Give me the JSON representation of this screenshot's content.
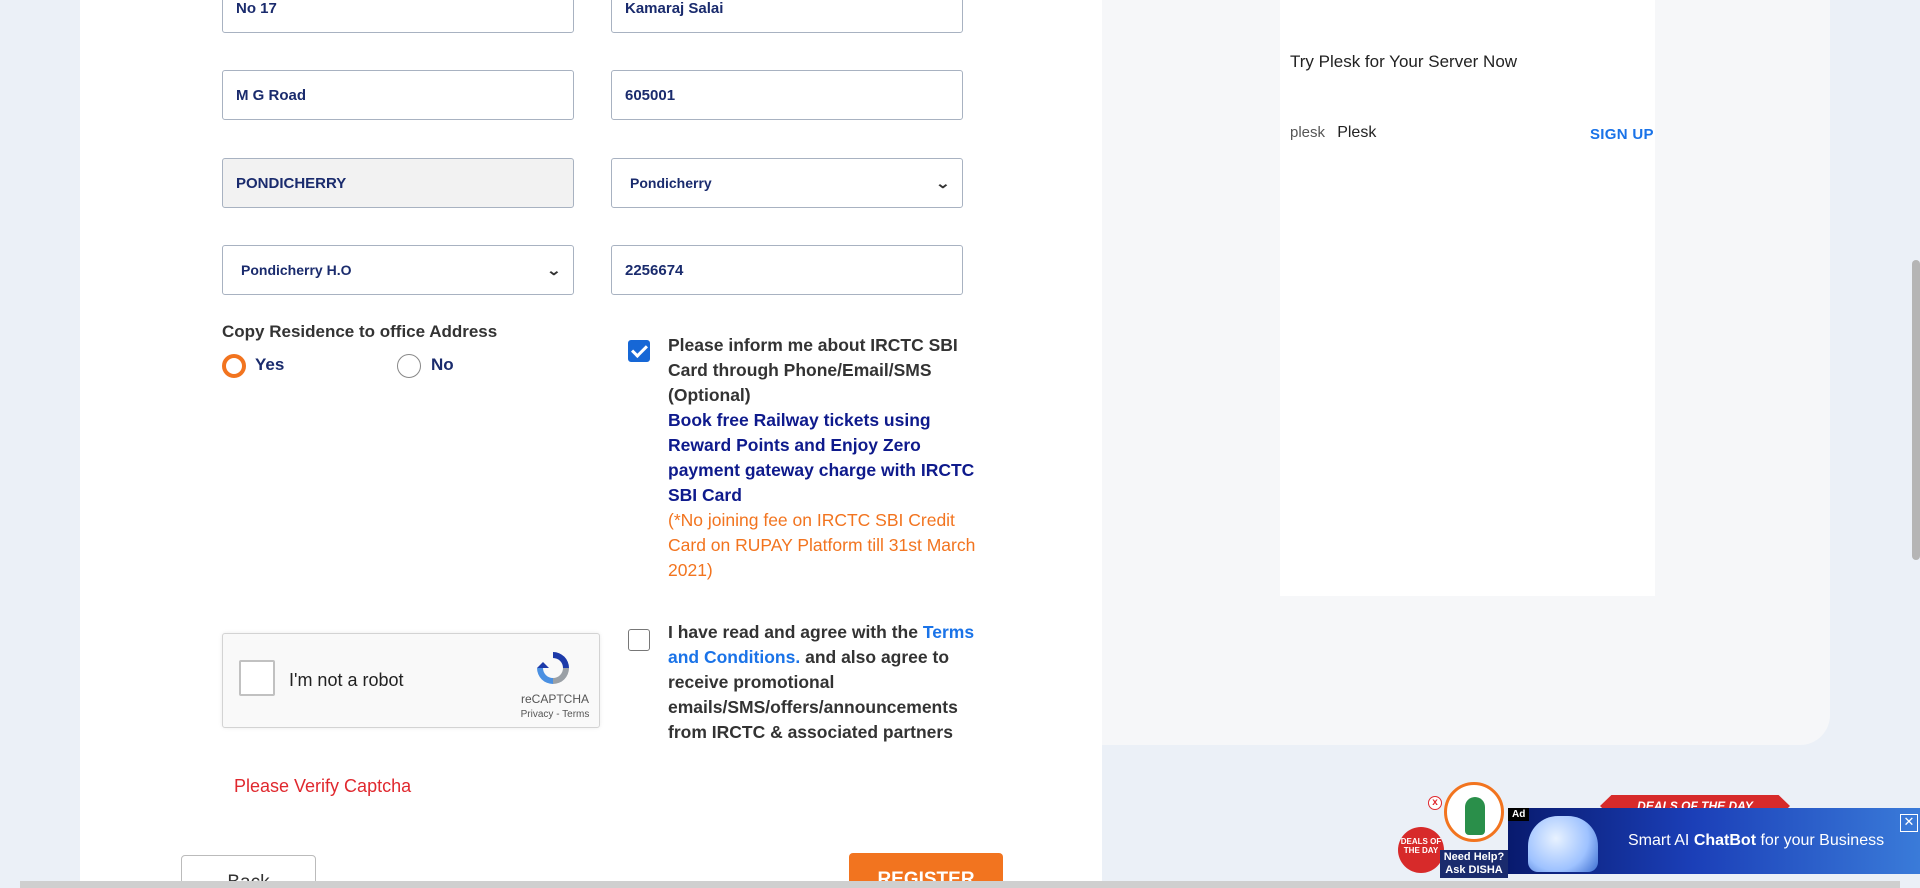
{
  "form": {
    "house_no": "No 17",
    "street": "Kamaraj Salai",
    "area": "M G Road",
    "pincode": "605001",
    "city": "PONDICHERRY",
    "state": "Pondicherry",
    "post_office": "Pondicherry H.O",
    "phone": "2256674",
    "copy_label": "Copy Residence to office Address",
    "radio_yes": "Yes",
    "radio_no": "No",
    "inform_text": "Please inform me about IRCTC SBI Card through Phone/Email/SMS (Optional)",
    "promo_text": "Book free Railway tickets using Reward Points and Enjoy Zero payment gateway charge with IRCTC SBI Card",
    "note_text": "(*No joining fee on IRCTC SBI Credit Card on RUPAY Platform till 31st March 2021)",
    "agree_prefix": "I have read and agree with the",
    "terms_link": "Terms and Conditions.",
    "agree_suffix": "and also agree to receive promotional emails/SMS/offers/announcements from IRCTC & associated partners",
    "captcha_label": "I'm not a robot",
    "captcha_brand": "reCAPTCHA",
    "captcha_links": "Privacy - Terms",
    "captcha_error": "Please Verify Captcha",
    "back_button": "Back",
    "register_button": "REGISTER"
  },
  "ad": {
    "title": "Try Plesk for Your Server Now",
    "logo_text": "plesk",
    "brand": "Plesk",
    "signup": "SIGN UP"
  },
  "help": {
    "deals_badge": "DEALS OF THE DAY",
    "need_help": "Need Help? Ask DISHA"
  },
  "banner": {
    "ad_tag": "Ad",
    "ribbon": "DEALS OF THE DAY",
    "text_prefix": "Smart AI",
    "text_bold": "ChatBot",
    "text_suffix": "for your Business"
  },
  "colors": {
    "accent": "#f2741f",
    "navy": "#1a2b6d",
    "link": "#1a73e8",
    "error": "#e0282e"
  }
}
